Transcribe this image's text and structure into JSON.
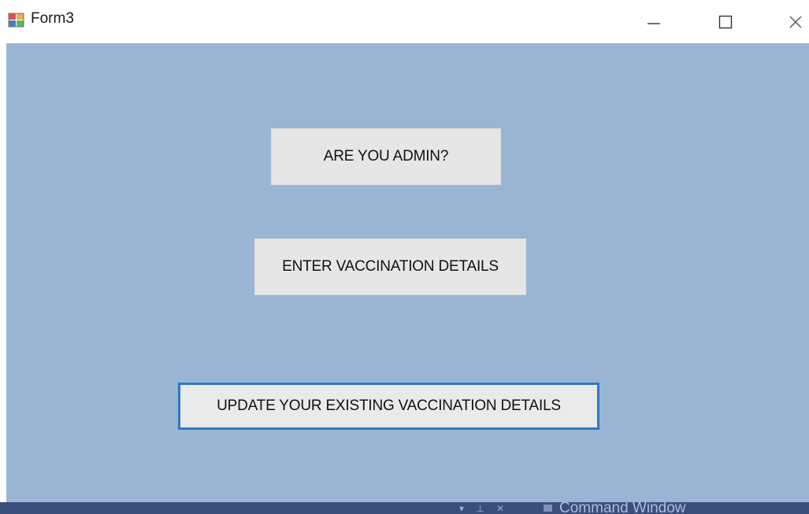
{
  "window": {
    "title": "Form3",
    "icon": "winforms-app-icon",
    "controls": {
      "minimize_icon": "minimize-icon",
      "maximize_icon": "maximize-icon",
      "close_icon": "close-icon"
    }
  },
  "form": {
    "background_color": "#9ab5d3",
    "buttons": {
      "admin": "ARE YOU ADMIN?",
      "enter_details": "ENTER VACCINATION DETAILS",
      "update_details": "UPDATE YOUR EXISTING VACCINATION DETAILS"
    },
    "focused_button": "update_details",
    "focus_color": "#2d79c7"
  },
  "taskbar": {
    "glyphs": "▾ ⊥ ✕",
    "label": "Command Window",
    "color": "#3b4f7c"
  }
}
